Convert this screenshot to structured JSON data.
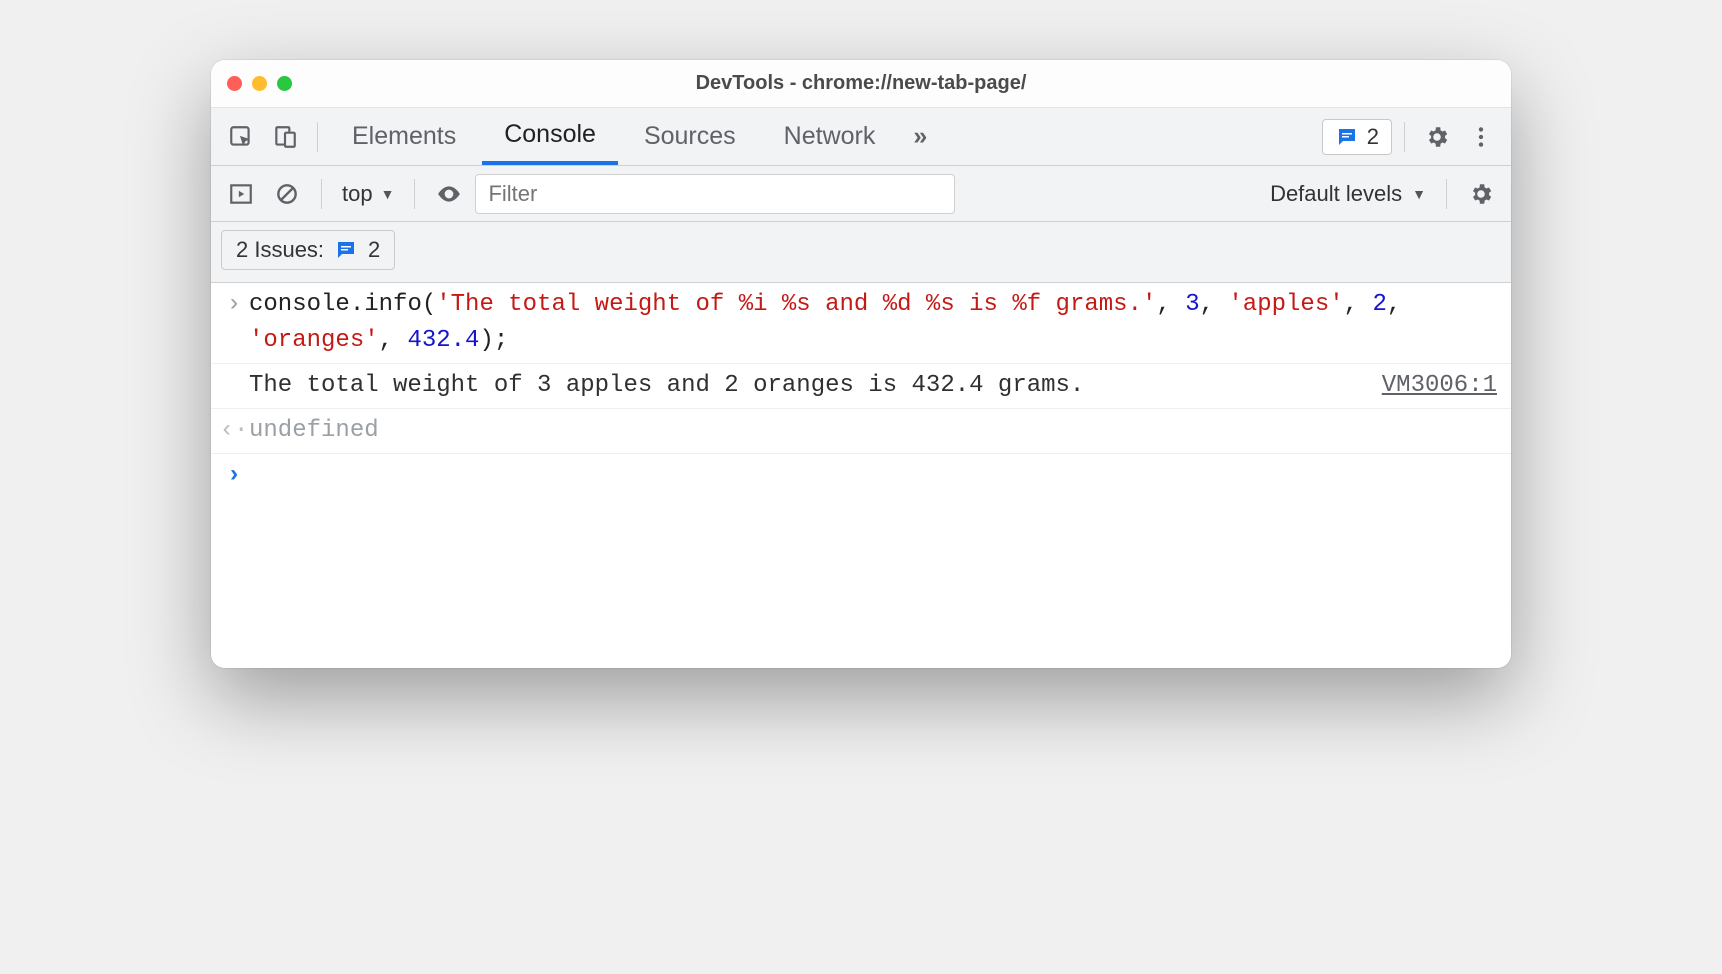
{
  "window": {
    "title": "DevTools - chrome://new-tab-page/"
  },
  "tabs": {
    "elements": "Elements",
    "console": "Console",
    "sources": "Sources",
    "network": "Network",
    "more_glyph": "»"
  },
  "issues_badge_count": "2",
  "toolbar": {
    "context_label": "top",
    "filter_placeholder": "Filter",
    "levels_label": "Default levels"
  },
  "issues_row": {
    "prefix": "2 Issues:",
    "count": "2"
  },
  "console_log": {
    "input_code": {
      "parts": [
        {
          "t": "obj",
          "v": "console"
        },
        {
          "t": "punc",
          "v": "."
        },
        {
          "t": "obj",
          "v": "info"
        },
        {
          "t": "punc",
          "v": "("
        },
        {
          "t": "str",
          "v": "'The total weight of %i %s and %d %s is %f grams.'"
        },
        {
          "t": "punc",
          "v": ", "
        },
        {
          "t": "num",
          "v": "3"
        },
        {
          "t": "punc",
          "v": ", "
        },
        {
          "t": "str",
          "v": "'apples'"
        },
        {
          "t": "punc",
          "v": ", "
        },
        {
          "t": "num",
          "v": "2"
        },
        {
          "t": "punc",
          "v": ", "
        },
        {
          "t": "str",
          "v": "'oranges'"
        },
        {
          "t": "punc",
          "v": ", "
        },
        {
          "t": "num",
          "v": "432.4"
        },
        {
          "t": "punc",
          "v": ");"
        }
      ]
    },
    "output_text": "The total weight of 3 apples and 2 oranges is 432.4 grams.",
    "output_source": "VM3006:1",
    "return_value": "undefined"
  },
  "glyphs": {
    "input_arrow": "›",
    "return_arrow": "‹·",
    "prompt_arrow": "›"
  }
}
